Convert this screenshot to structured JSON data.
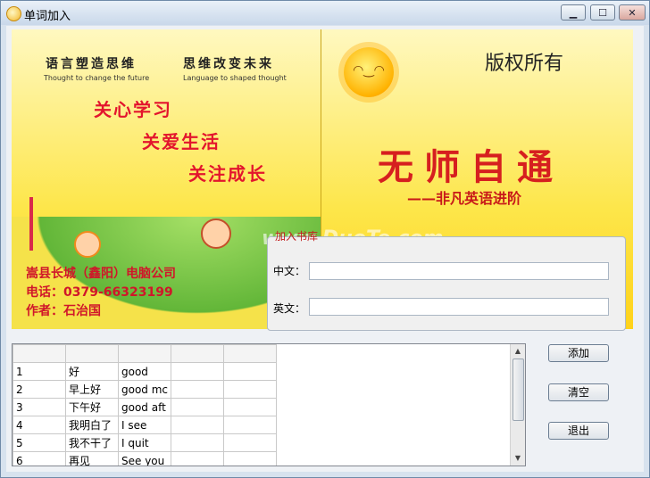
{
  "window": {
    "title": "单词加入"
  },
  "banner": {
    "slogan_left_cn": "语言塑造思维",
    "slogan_left_en": "Thought to change the future",
    "slogan_right_cn": "思维改变未来",
    "slogan_right_en": "Language to shaped thought",
    "line1": "关心学习",
    "line2": "关爱生活",
    "line3": "关注成长",
    "copyright": "版权所有",
    "app_title": "无师自通",
    "app_subtitle": "——非凡英语进阶",
    "company": "嵩县长城（鑫阳）电脑公司",
    "phone": "电话：0379-66323199",
    "author": "作者：石治国",
    "watermark": "www.DuoTe.com"
  },
  "form": {
    "group_title": "加入书库",
    "chinese_label": "中文：",
    "chinese_value": "",
    "english_label": "英文：",
    "english_value": ""
  },
  "buttons": {
    "add": "添加",
    "clear": "清空",
    "exit": "退出"
  },
  "table": {
    "rows": [
      [
        "1",
        "好",
        "good",
        "",
        ""
      ],
      [
        "2",
        "早上好",
        "good mc",
        "",
        ""
      ],
      [
        "3",
        "下午好",
        "good aft",
        "",
        ""
      ],
      [
        "4",
        "我明白了",
        "I see",
        "",
        ""
      ],
      [
        "5",
        "我不干了",
        "I quit",
        "",
        ""
      ],
      [
        "6",
        "再见",
        "See you",
        "",
        ""
      ]
    ]
  },
  "colors": {
    "banner_yellow": "#fde64a",
    "slogan_red": "#e3152d",
    "legend_red": "#c32020"
  }
}
